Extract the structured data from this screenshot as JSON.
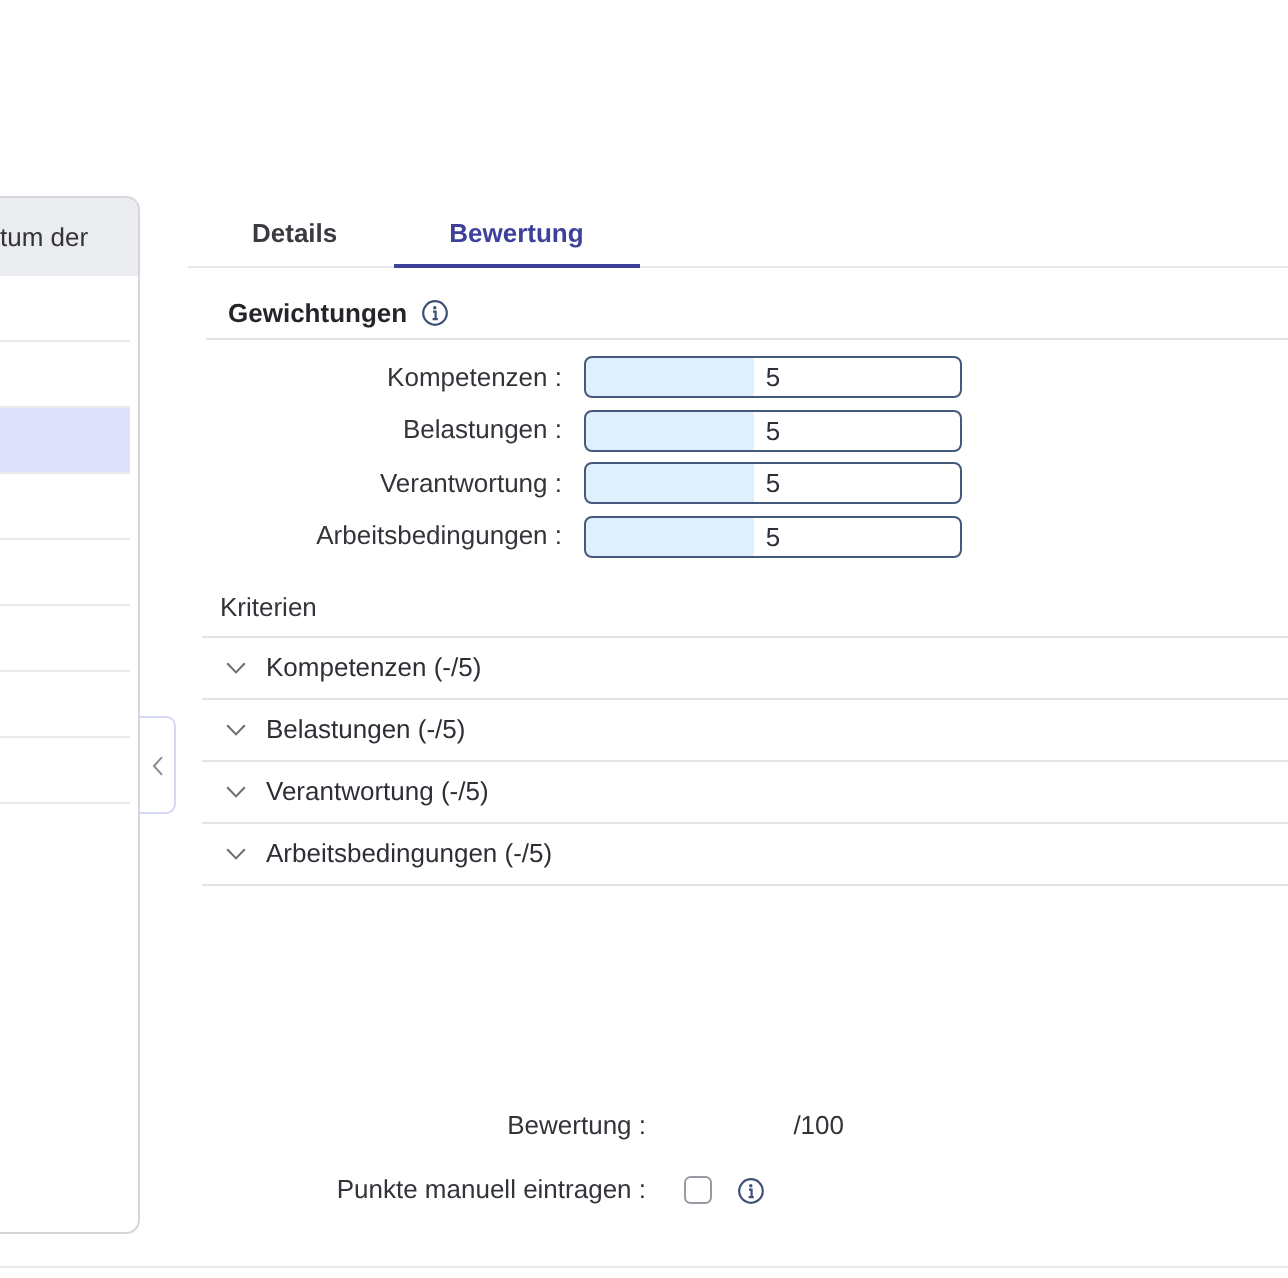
{
  "list_panel": {
    "column_header": "tum der",
    "rows": [
      {
        "selected": false
      },
      {
        "selected": false
      },
      {
        "selected": true
      },
      {
        "selected": false
      },
      {
        "selected": false
      },
      {
        "selected": false
      },
      {
        "selected": false
      },
      {
        "selected": false
      }
    ]
  },
  "tabs": [
    {
      "label": "Details",
      "selected": false
    },
    {
      "label": "Bewertung",
      "selected": true
    }
  ],
  "weights": {
    "title": "Gewichtungen",
    "fields": [
      {
        "label": "Kompetenzen :",
        "value": "5"
      },
      {
        "label": "Belastungen :",
        "value": "5"
      },
      {
        "label": "Verantwortung :",
        "value": "5"
      },
      {
        "label": "Arbeitsbedingungen :",
        "value": "5"
      }
    ]
  },
  "criteria": {
    "title": "Kriterien",
    "items": [
      {
        "label": "Kompetenzen (-/5)",
        "expanded": false
      },
      {
        "label": "Belastungen (-/5)",
        "expanded": false
      },
      {
        "label": "Verantwortung (-/5)",
        "expanded": false
      },
      {
        "label": "Arbeitsbedingungen (-/5)",
        "expanded": false
      }
    ]
  },
  "summary": {
    "score": {
      "label": "Bewertung :",
      "value": "/100"
    },
    "manual_entry": {
      "label": "Punkte manuell eintragen :",
      "checked": false
    }
  }
}
